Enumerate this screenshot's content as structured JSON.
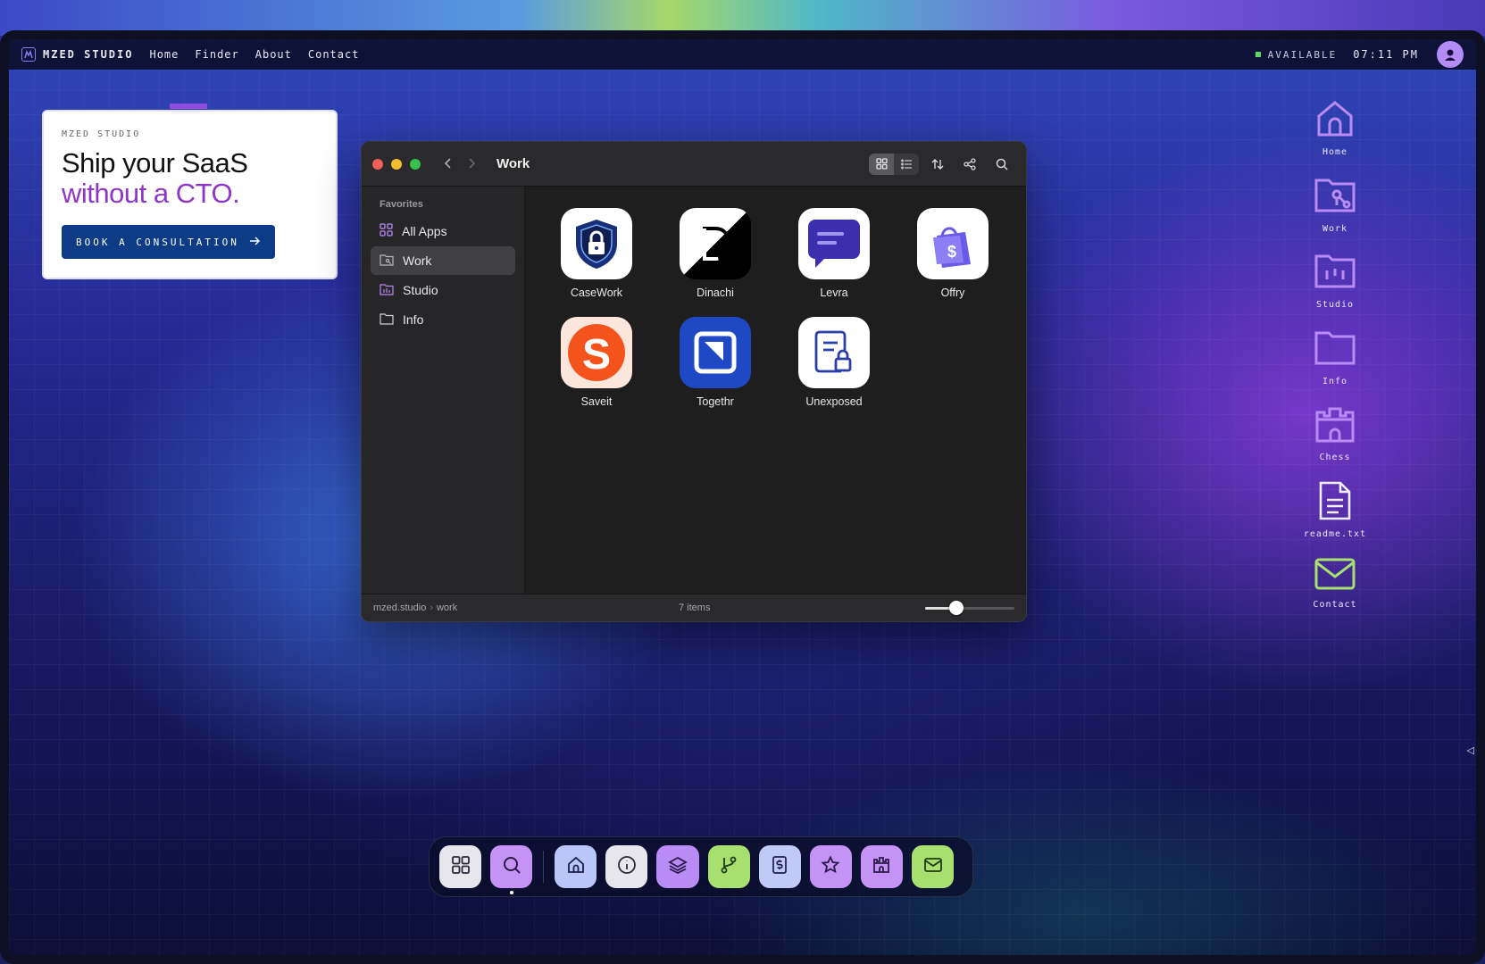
{
  "menubar": {
    "brand": "MZED STUDIO",
    "nav": [
      "Home",
      "Finder",
      "About",
      "Contact"
    ],
    "status": "AVAILABLE",
    "time": "07:11 PM"
  },
  "promo": {
    "eyebrow": "MZED STUDIO",
    "headline_line1": "Ship your SaaS",
    "headline_line2": "without a CTO.",
    "cta": "BOOK A CONSULTATION",
    "accent_color": "#8e36c8",
    "cta_color": "#0d3b85"
  },
  "finder": {
    "title": "Work",
    "sidebar_heading": "Favorites",
    "sidebar_items": [
      {
        "label": "All Apps",
        "icon": "grid-icon"
      },
      {
        "label": "Work",
        "icon": "folder-work-icon",
        "active": true
      },
      {
        "label": "Studio",
        "icon": "folder-studio-icon"
      },
      {
        "label": "Info",
        "icon": "folder-icon"
      }
    ],
    "apps": [
      {
        "label": "CaseWork",
        "icon": "shield-lock-icon"
      },
      {
        "label": "Dinachi",
        "icon": "dinachi-d-icon"
      },
      {
        "label": "Levra",
        "icon": "chat-bubble-icon"
      },
      {
        "label": "Offry",
        "icon": "shopping-bag-dollar-icon"
      },
      {
        "label": "Saveit",
        "icon": "saveit-s-icon"
      },
      {
        "label": "Togethr",
        "icon": "togethr-square-icon"
      },
      {
        "label": "Unexposed",
        "icon": "doc-lock-icon"
      }
    ],
    "path_root": "mzed.studio",
    "path_sep": "›",
    "path_leaf": "work",
    "item_count": "7 items",
    "zoom_fraction": 0.35
  },
  "desktop_icons": [
    "Home",
    "Work",
    "Studio",
    "Info",
    "Chess",
    "readme.txt",
    "Contact"
  ],
  "dock": [
    {
      "name": "all-apps",
      "icon": "grid-icon",
      "color": "#e6e6ec"
    },
    {
      "name": "search",
      "icon": "search-icon",
      "color": "#c593f5"
    },
    {
      "name": "home",
      "icon": "home-icon",
      "color": "#b9c6f7"
    },
    {
      "name": "info",
      "icon": "info-icon",
      "color": "#e6e6ec"
    },
    {
      "name": "layers",
      "icon": "layers-icon",
      "color": "#b98cf5"
    },
    {
      "name": "git",
      "icon": "git-branch-icon",
      "color": "#a8e070"
    },
    {
      "name": "pricing",
      "icon": "dollar-doc-icon",
      "color": "#c1c9f7"
    },
    {
      "name": "favorites",
      "icon": "star-icon",
      "color": "#c593f5"
    },
    {
      "name": "chess",
      "icon": "castle-icon",
      "color": "#c593f5"
    },
    {
      "name": "mail",
      "icon": "mail-icon",
      "color": "#a8e070"
    }
  ]
}
